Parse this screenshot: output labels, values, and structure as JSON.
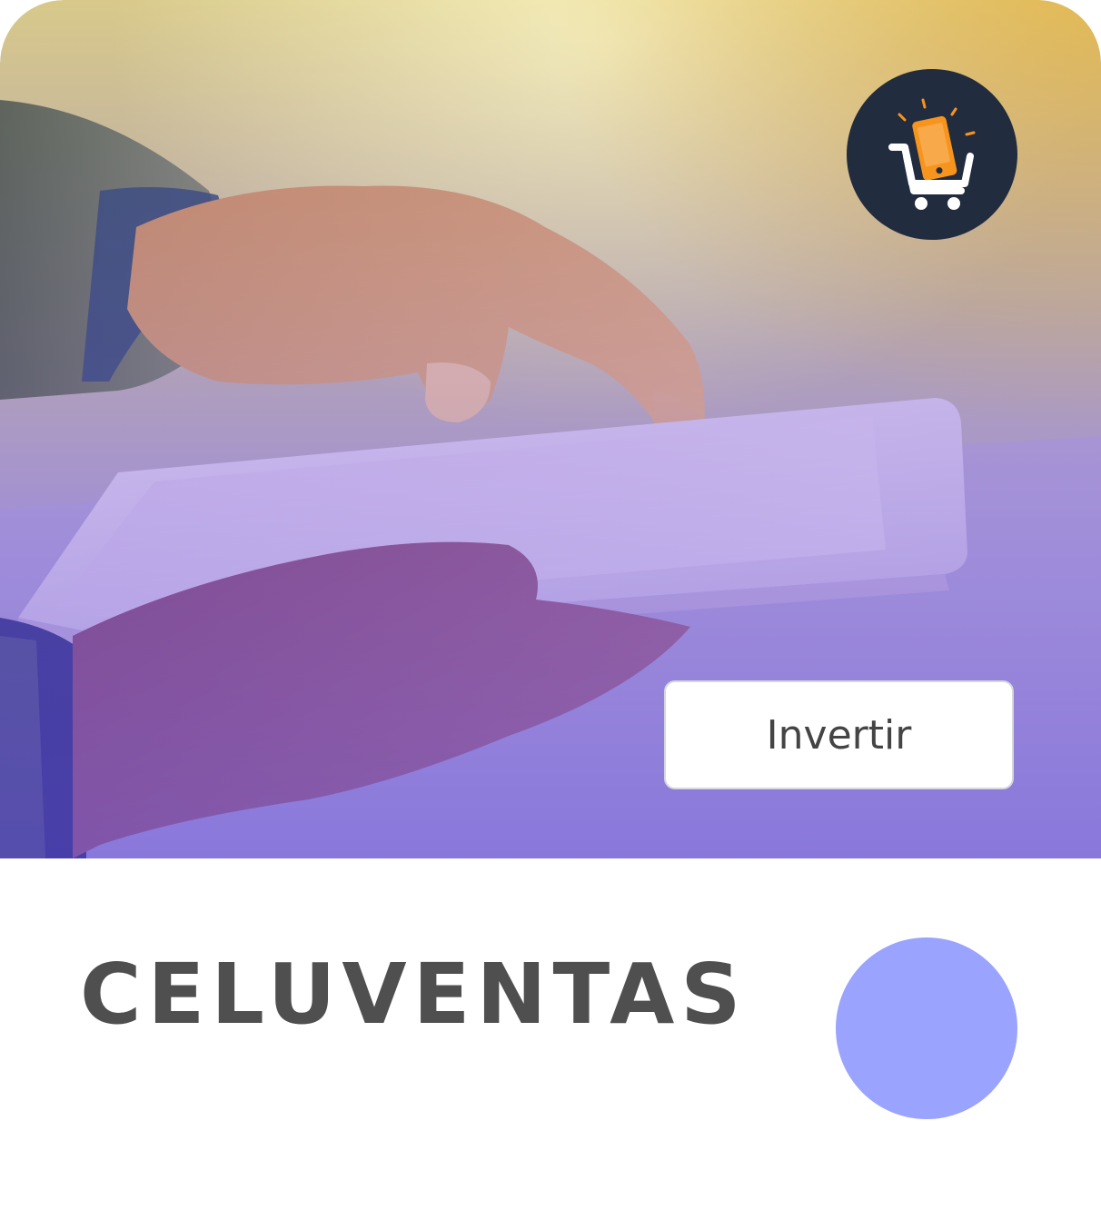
{
  "card": {
    "title": "CELUVENTAS",
    "button_label": "Invertir",
    "badge_icon": "phone-cart-icon",
    "accent_color": "#9aa3fd",
    "badge_color": "#222c3f",
    "badge_icon_color": "#f7941d"
  },
  "hero_image": {
    "description_icon": "hands-tablet-photo"
  }
}
